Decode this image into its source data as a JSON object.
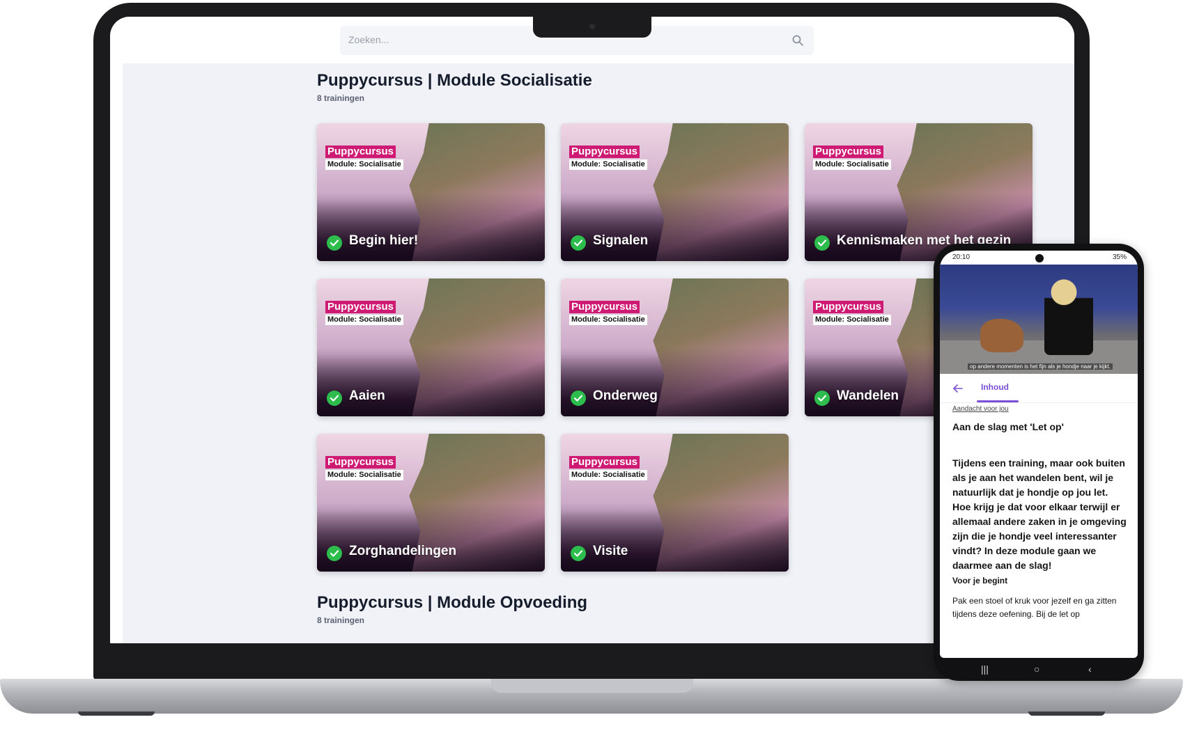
{
  "search": {
    "placeholder": "Zoeken..."
  },
  "sections": [
    {
      "title": "Puppycursus | Module Socialisatie",
      "count": "8 trainingen"
    },
    {
      "title": "Puppycursus | Module Opvoeding",
      "count": "8 trainingen"
    }
  ],
  "cards": [
    {
      "tag": "Puppycursus",
      "module": "Module: Socialisatie",
      "title": "Begin hier!",
      "completed": true
    },
    {
      "tag": "Puppycursus",
      "module": "Module: Socialisatie",
      "title": "Signalen",
      "completed": true
    },
    {
      "tag": "Puppycursus",
      "module": "Module: Socialisatie",
      "title": "Kennismaken met het gezin",
      "completed": true
    },
    {
      "tag": "Puppycursus",
      "module": "Module: Socialisatie",
      "title": "Aaien",
      "completed": true
    },
    {
      "tag": "Puppycursus",
      "module": "Module: Socialisatie",
      "title": "Onderweg",
      "completed": true
    },
    {
      "tag": "Puppycursus",
      "module": "Module: Socialisatie",
      "title": "Wandelen",
      "completed": true
    },
    {
      "tag": "Puppycursus",
      "module": "Module: Socialisatie",
      "title": "Zorghandelingen",
      "completed": true
    },
    {
      "tag": "Puppycursus",
      "module": "Module: Socialisatie",
      "title": "Visite",
      "completed": true
    }
  ],
  "phone": {
    "status_time": "20:10",
    "status_battery": "35%",
    "video_caption": "op andere momenten is het fijn als je hondje naar je kijkt.",
    "tab": "Inhoud",
    "kicker": "Aandacht voor jou",
    "heading": "Aan de slag met 'Let op'",
    "body": "Tijdens een training, maar ook buiten als je aan het wandelen bent, wil je natuurlijk dat je hondje op jou let. Hoe krijg je dat voor elkaar terwijl er allemaal andere zaken in je omgeving zijn die je hondje veel interessanter vindt? In deze module gaan we daarmee aan de slag!",
    "subheading": "Voor je begint",
    "text": "Pak een stoel of kruk voor jezelf en ga zitten tijdens deze oefening. Bij de let op"
  },
  "colors": {
    "tag_pink": "#cf1a73",
    "check_green": "#2dbd4c",
    "accent_purple": "#7a4fd6"
  },
  "icons": [
    "search-icon",
    "check-icon",
    "arrow-left-icon"
  ]
}
